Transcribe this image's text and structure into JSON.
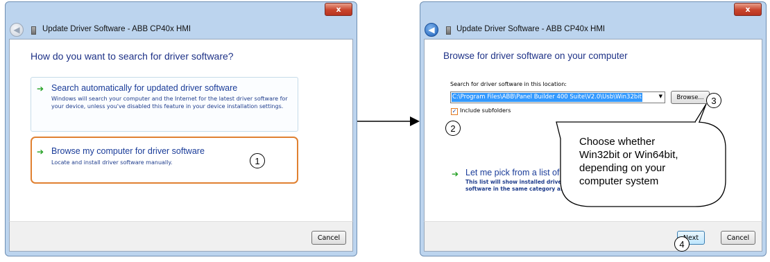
{
  "dialog1": {
    "title": "Update Driver Software - ABB CP40x HMI",
    "close_label": "x",
    "heading": "How do you want to search for driver software?",
    "option_auto": {
      "title": "Search automatically for updated driver software",
      "description": "Windows will search your computer and the Internet for the latest driver software for your device, unless you've disabled this feature in your device installation settings."
    },
    "option_browse": {
      "title": "Browse my computer for driver software",
      "description": "Locate and install driver software manually.",
      "step": "1"
    },
    "cancel_label": "Cancel"
  },
  "dialog2": {
    "title": "Update Driver Software - ABB CP40x HMI",
    "close_label": "x",
    "heading": "Browse for driver software on your computer",
    "location_label": "Search for driver software in this location:",
    "location_value": "C:\\Program Files\\ABB\\Panel Builder 400 Suite\\V2.0\\Usb\\Win32bit",
    "browse_label": "Browse...",
    "browse_step": "3",
    "include_subfolders_label": "Include subfolders",
    "include_subfolders_checked": true,
    "subfolders_step": "2",
    "pick_option": {
      "title": "Let me pick from a list of",
      "description_line1": "This list will show installed driver",
      "description_line2": "software in the same category as"
    },
    "next_label": "Next",
    "next_step": "4",
    "cancel_label": "Cancel"
  },
  "callout": {
    "lines": [
      "Choose whether",
      "Win32bit or Win64bit,",
      "depending on your",
      "computer system"
    ]
  },
  "icons": {
    "green_arrow": "→",
    "back": "←",
    "checkmark": "✓",
    "dropdown": "▼"
  },
  "colors": {
    "heading_blue": "#1e3287",
    "link_blue": "#1a3c99",
    "highlight_orange": "#e08030",
    "selection_blue": "#3399ff",
    "green_arrow": "#22a022"
  }
}
